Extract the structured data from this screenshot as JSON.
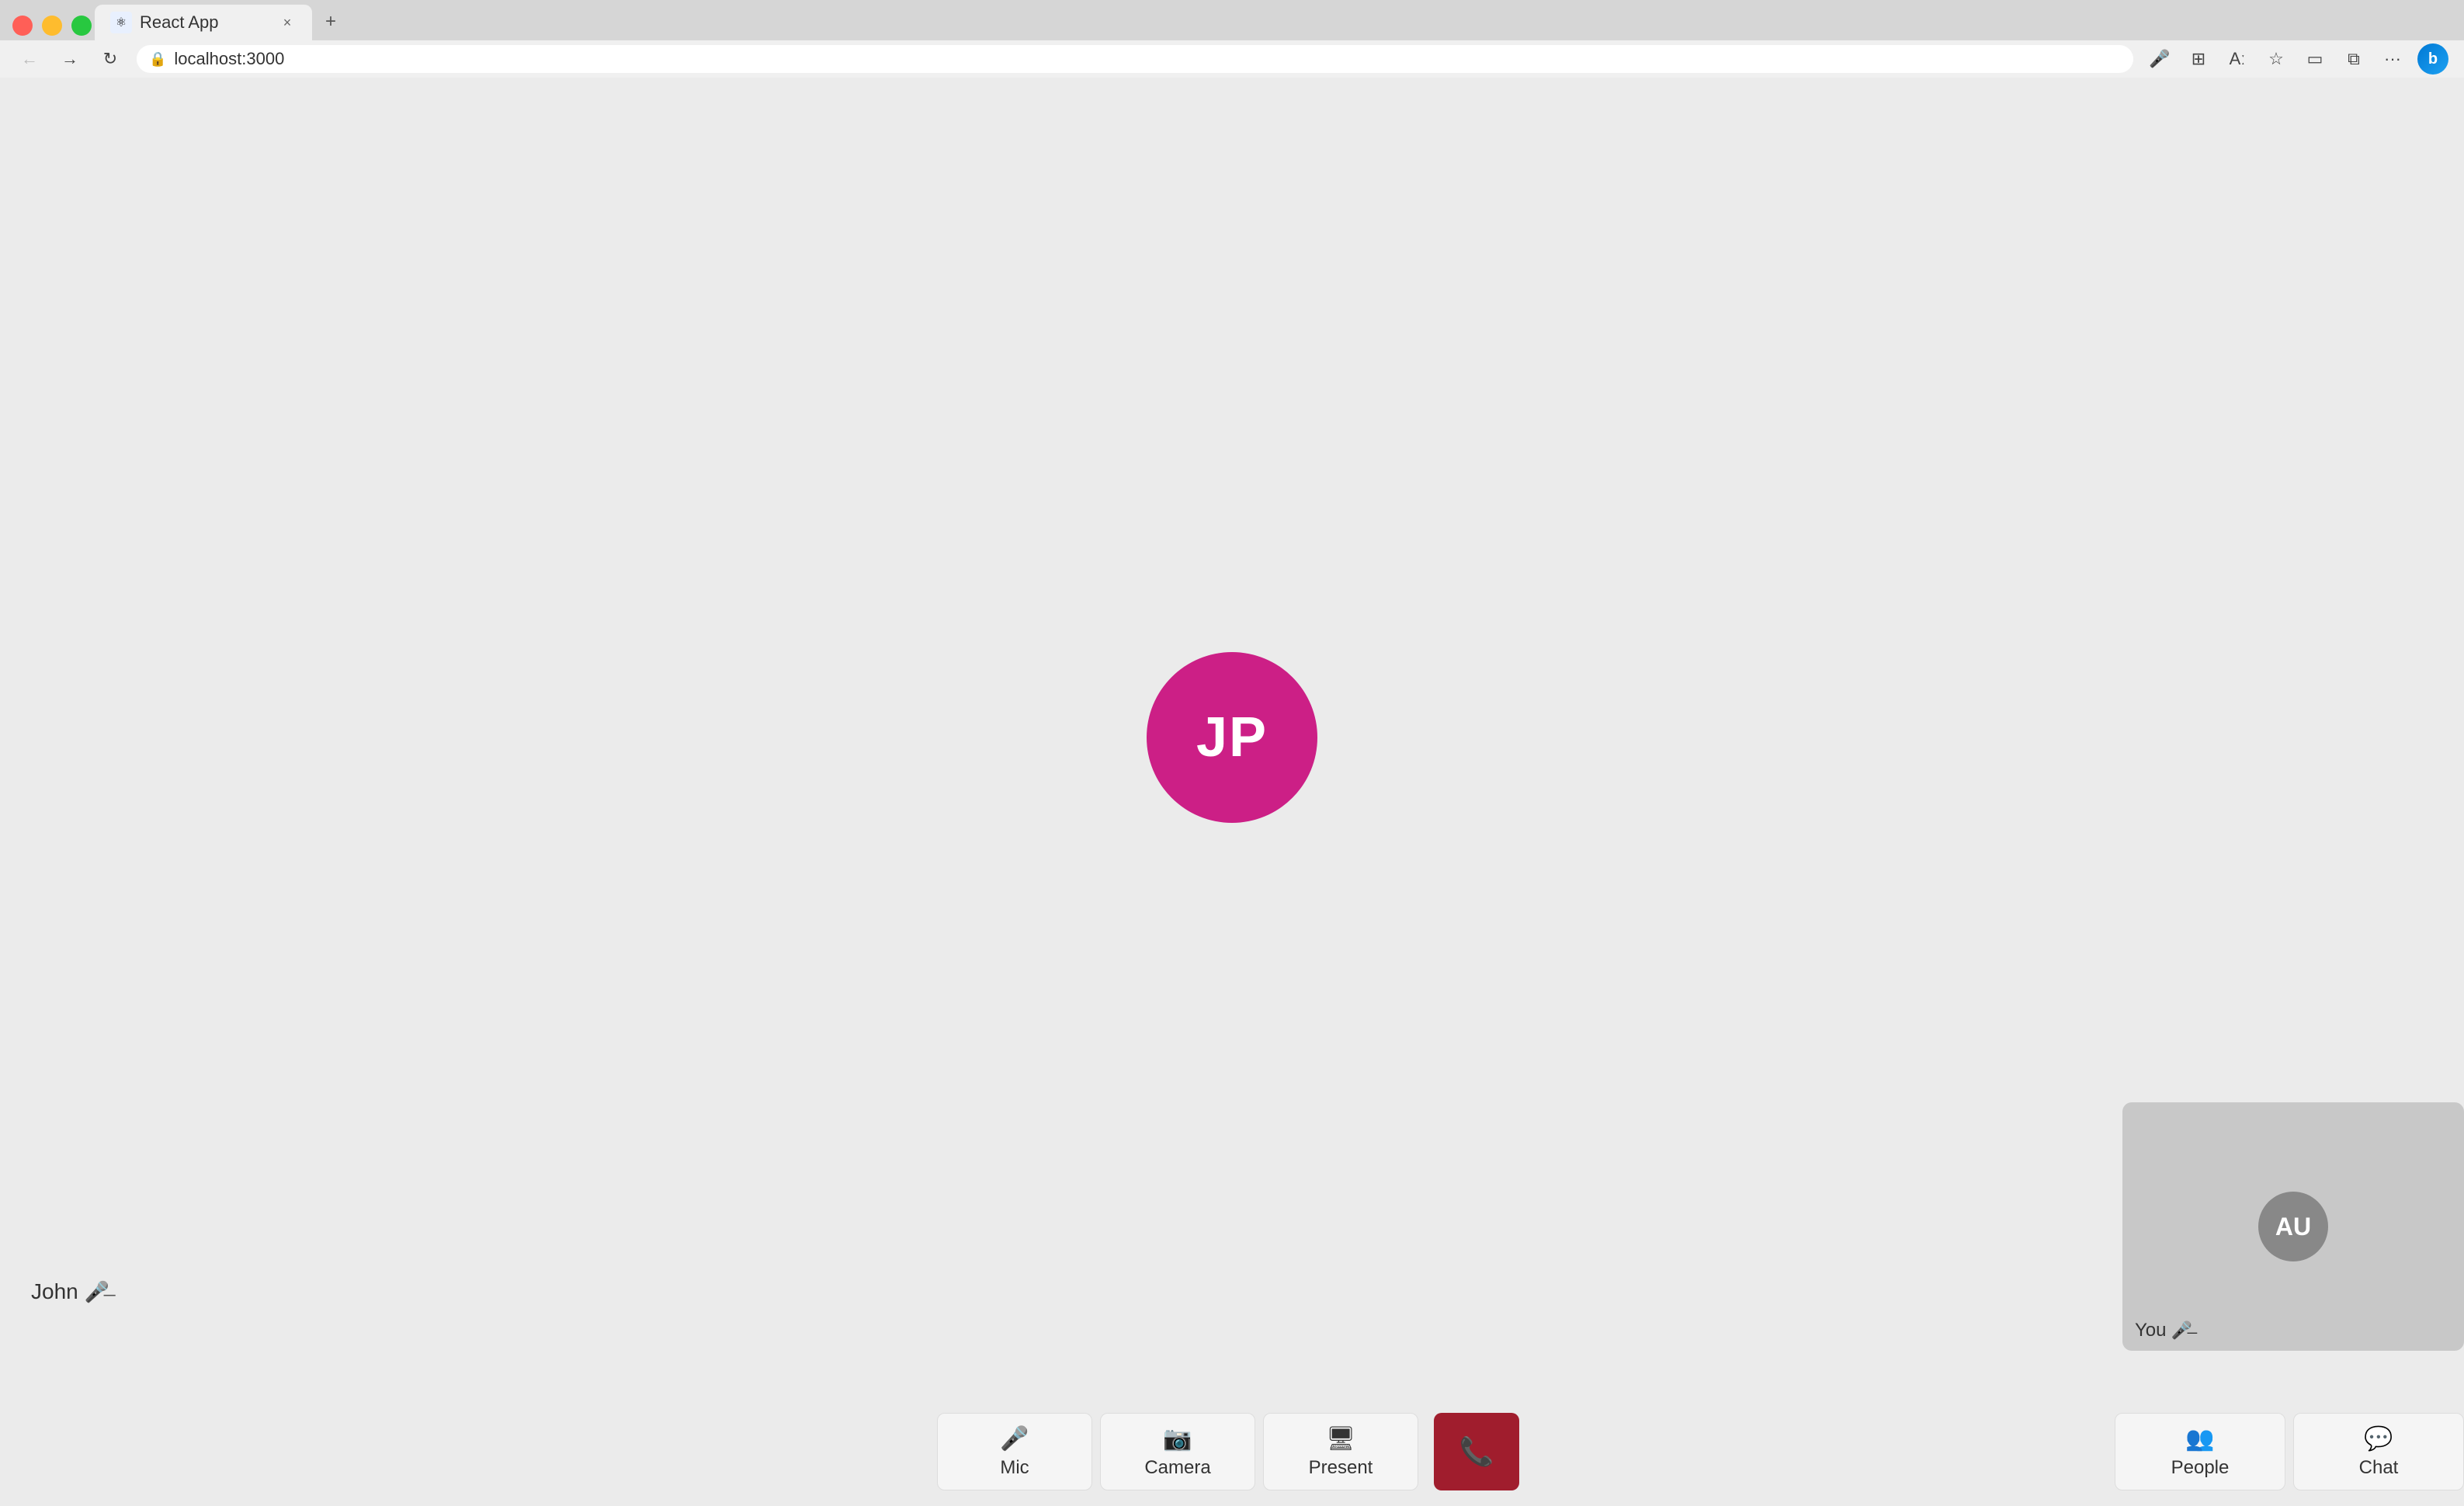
{
  "browser": {
    "tab_title": "React App",
    "tab_favicon": "⚛",
    "url": "localhost:3000",
    "close_tab_label": "×",
    "new_tab_label": "+",
    "back_disabled": true
  },
  "call": {
    "main_participant_initials": "JP",
    "main_participant_color": "#cc1f86",
    "main_participant_name": "John",
    "self_initials": "AU",
    "self_label": "You"
  },
  "controls": {
    "mic_label": "Mic",
    "camera_label": "Camera",
    "present_label": "Present",
    "people_label": "People",
    "chat_label": "Chat"
  }
}
